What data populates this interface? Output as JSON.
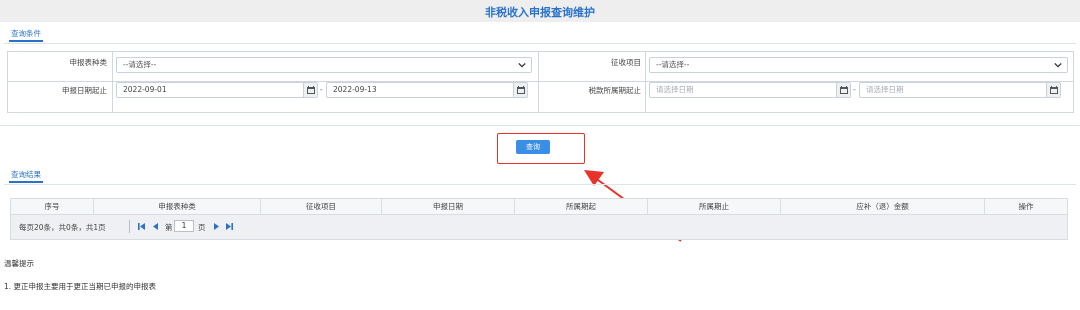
{
  "page": {
    "title": "非税收入申报查询维护"
  },
  "query_section": {
    "tab_label": "查询条件",
    "report_type": {
      "label": "申报表种类",
      "value": "--请选择--"
    },
    "collection_item": {
      "label": "征收项目",
      "value": "--请选择--"
    },
    "report_date": {
      "label": "申报日期起止",
      "start": "2022-09-01",
      "end": "2022-09-13"
    },
    "tax_period": {
      "label": "税款所属期起止",
      "start_placeholder": "请选择日期",
      "end_placeholder": "请选择日期"
    },
    "range_separator": "-",
    "query_button": "查询"
  },
  "results_section": {
    "tab_label": "查询结果",
    "columns": [
      "序号",
      "申报表种类",
      "征收项目",
      "申报日期",
      "所属期起",
      "所属期止",
      "应补（退）金额",
      "操作"
    ],
    "pager": {
      "summary": "每页20条，共0条，共1页",
      "page_prefix": "第",
      "page_value": "1",
      "page_suffix": "页"
    }
  },
  "tips": {
    "title": "温馨提示",
    "lines": [
      "1. 更正申报主要用于更正当期已申报的申报表"
    ]
  },
  "colors": {
    "accent": "#2a72c9",
    "button": "#3a8ee6",
    "highlight": "#e8322a"
  }
}
